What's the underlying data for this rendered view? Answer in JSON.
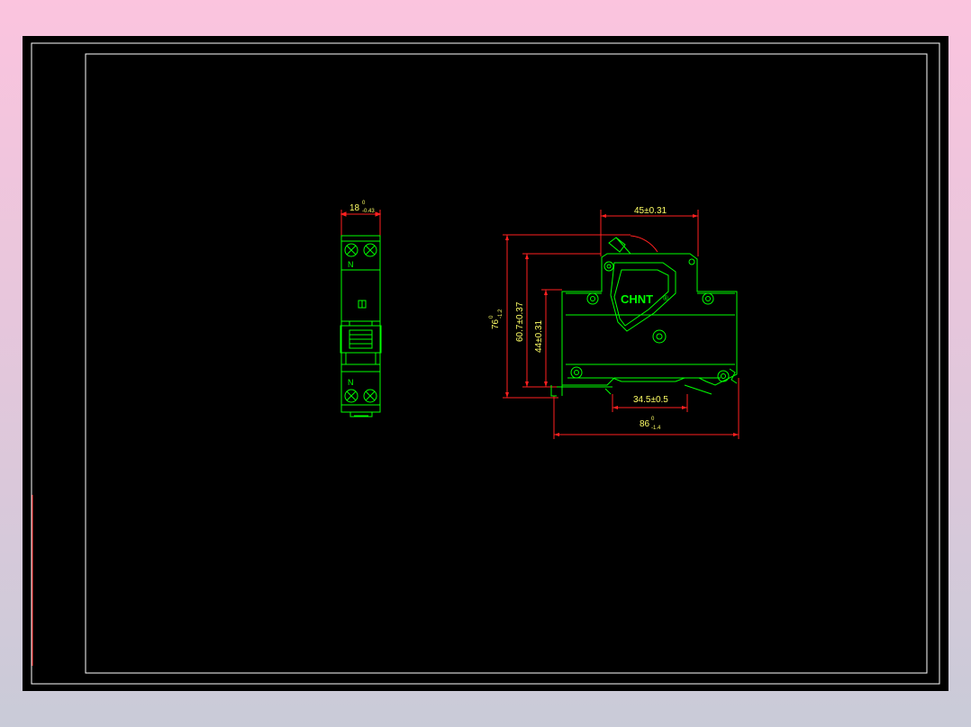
{
  "colors": {
    "background": "#000000",
    "frame": "#ffffff",
    "outline": "#00ff00",
    "dimension_line": "#ff2020",
    "dimension_text": "#ffff66",
    "page_gradient_top": "#fbc4de",
    "page_gradient_bottom": "#c9cbd8"
  },
  "front_view": {
    "width_dim": {
      "main": "18",
      "upper": "0",
      "lower": "-0.43"
    },
    "terminal_label_top": "N",
    "terminal_label_bottom": "N"
  },
  "side_view": {
    "brand_logo": "CHNT",
    "top_dim": "45±0.31",
    "height_total": {
      "main": "76",
      "upper": "0",
      "lower": "-1.2"
    },
    "height_mid": "60.7±0.37",
    "height_inner": "44±0.31",
    "rail_dim": "34.5±0.5",
    "depth_dim": {
      "main": "86",
      "upper": "0",
      "lower": "-1.4"
    }
  }
}
